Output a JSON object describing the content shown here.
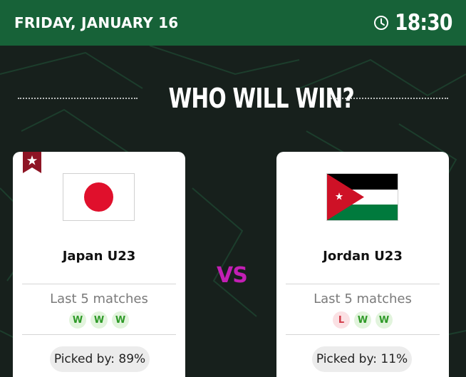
{
  "header": {
    "date": "FRIDAY, JANUARY 16",
    "time": "18:30",
    "background": "#176238"
  },
  "title": "WHO WILL WIN?",
  "vs_label": "VS",
  "teams": [
    {
      "name": "Japan U23",
      "flag": "japan-flag",
      "favorite": true,
      "last5_label": "Last 5 matches",
      "form": [
        "W",
        "W",
        "W"
      ],
      "picked": "Picked by: 89%"
    },
    {
      "name": "Jordan U23",
      "flag": "jordan-flag",
      "favorite": false,
      "last5_label": "Last 5 matches",
      "form": [
        "L",
        "W",
        "W"
      ],
      "picked": "Picked by: 11%"
    }
  ],
  "colors": {
    "win": "#2f9a28",
    "loss": "#d23a48",
    "vs": "#c21fb4",
    "favorite": "#8e1525"
  }
}
